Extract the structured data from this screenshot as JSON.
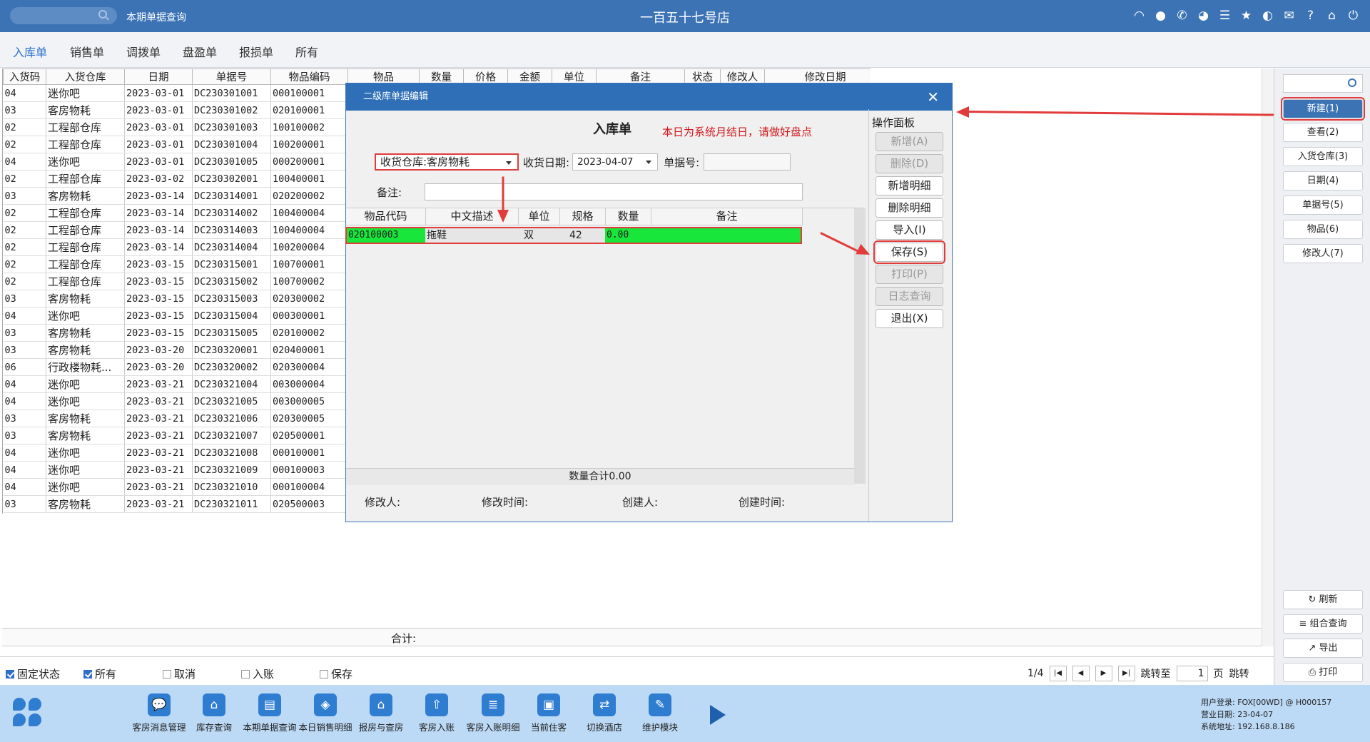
{
  "topbar": {
    "subtitle": "本期单据查询",
    "title": "一百五十七号店",
    "icons": [
      "wifi-icon",
      "chat-icon",
      "phone-icon",
      "palette-icon",
      "menu-icon",
      "star-icon",
      "theme-icon",
      "mail-icon",
      "help-icon",
      "home-icon",
      "power-icon"
    ]
  },
  "tabs": [
    {
      "label": "入库单",
      "active": true
    },
    {
      "label": "销售单"
    },
    {
      "label": "调拨单"
    },
    {
      "label": "盘盈单"
    },
    {
      "label": "报损单"
    },
    {
      "label": "所有"
    }
  ],
  "grid": {
    "columns": [
      "入货码",
      "入货仓库",
      "日期",
      "单据号",
      "物品编码",
      "物品",
      "数量",
      "价格",
      "金额",
      "单位",
      "备注",
      "状态",
      "修改人",
      "修改日期"
    ],
    "rows": [
      [
        "04",
        "迷你吧",
        "2023-03-01",
        "DC230301001",
        "000100001"
      ],
      [
        "03",
        "客房物耗",
        "2023-03-01",
        "DC230301002",
        "020100001"
      ],
      [
        "02",
        "工程部仓库",
        "2023-03-01",
        "DC230301003",
        "100100002"
      ],
      [
        "02",
        "工程部仓库",
        "2023-03-01",
        "DC230301004",
        "100200001"
      ],
      [
        "04",
        "迷你吧",
        "2023-03-01",
        "DC230301005",
        "000200001"
      ],
      [
        "02",
        "工程部仓库",
        "2023-03-02",
        "DC230302001",
        "100400001"
      ],
      [
        "03",
        "客房物耗",
        "2023-03-14",
        "DC230314001",
        "020200002"
      ],
      [
        "02",
        "工程部仓库",
        "2023-03-14",
        "DC230314002",
        "100400004"
      ],
      [
        "02",
        "工程部仓库",
        "2023-03-14",
        "DC230314003",
        "100400004"
      ],
      [
        "02",
        "工程部仓库",
        "2023-03-14",
        "DC230314004",
        "100200004"
      ],
      [
        "02",
        "工程部仓库",
        "2023-03-15",
        "DC230315001",
        "100700001"
      ],
      [
        "02",
        "工程部仓库",
        "2023-03-15",
        "DC230315002",
        "100700002"
      ],
      [
        "03",
        "客房物耗",
        "2023-03-15",
        "DC230315003",
        "020300002"
      ],
      [
        "04",
        "迷你吧",
        "2023-03-15",
        "DC230315004",
        "000300001"
      ],
      [
        "03",
        "客房物耗",
        "2023-03-15",
        "DC230315005",
        "020100002"
      ],
      [
        "03",
        "客房物耗",
        "2023-03-20",
        "DC230320001",
        "020400001"
      ],
      [
        "06",
        "行政楼物耗...",
        "2023-03-20",
        "DC230320002",
        "020300004"
      ],
      [
        "04",
        "迷你吧",
        "2023-03-21",
        "DC230321004",
        "003000004"
      ],
      [
        "04",
        "迷你吧",
        "2023-03-21",
        "DC230321005",
        "003000005"
      ],
      [
        "03",
        "客房物耗",
        "2023-03-21",
        "DC230321006",
        "020300005"
      ],
      [
        "03",
        "客房物耗",
        "2023-03-21",
        "DC230321007",
        "020500001"
      ],
      [
        "04",
        "迷你吧",
        "2023-03-21",
        "DC230321008",
        "000100001"
      ],
      [
        "04",
        "迷你吧",
        "2023-03-21",
        "DC230321009",
        "000100003"
      ],
      [
        "04",
        "迷你吧",
        "2023-03-21",
        "DC230321010",
        "000100004"
      ],
      [
        "03",
        "客房物耗",
        "2023-03-21",
        "DC230321011",
        "020500003"
      ]
    ],
    "sum_label": "合计:"
  },
  "status": {
    "filters": [
      {
        "label": "固定状态",
        "checked": true
      },
      {
        "label": "所有",
        "checked": true
      },
      {
        "label": "取消",
        "checked": false
      },
      {
        "label": "入账",
        "checked": false
      },
      {
        "label": "保存",
        "checked": false
      }
    ],
    "page": "1/4",
    "jump_label": "跳转至",
    "page_input": "1",
    "page_unit": "页",
    "jump_button": "跳转"
  },
  "right_panel": {
    "buttons": [
      "新建(1)",
      "查看(2)",
      "入货仓库(3)",
      "日期(4)",
      "单据号(5)",
      "物品(6)",
      "修改人(7)"
    ],
    "bottom_buttons": [
      "刷新",
      "组合查询",
      "导出",
      "打印"
    ]
  },
  "modal": {
    "header": "二级库单据编辑",
    "title": "入库单",
    "notice": "本日为系统月结日，请做好盘点",
    "warehouse_value": "收货仓库:客房物耗",
    "date_label": "收货日期:",
    "date_value": "2023-04-07",
    "doc_label": "单据号:",
    "remark_label": "备注:",
    "detail_columns": [
      "物品代码",
      "中文描述",
      "单位",
      "规格",
      "数量",
      "备注"
    ],
    "detail_row": [
      "020100003",
      "拖鞋",
      "双",
      "42",
      "0.00",
      ""
    ],
    "qty_total": "数量合计0.00",
    "footer": [
      "修改人:",
      "修改时间:",
      "创建人:",
      "创建时间:"
    ],
    "ops_title": "操作面板",
    "ops": [
      {
        "label": "新增(A)",
        "disabled": true
      },
      {
        "label": "删除(D)",
        "disabled": true
      },
      {
        "label": "新增明细",
        "disabled": false
      },
      {
        "label": "删除明细",
        "disabled": false
      },
      {
        "label": "导入(I)",
        "disabled": false
      },
      {
        "label": "保存(S)",
        "disabled": false
      },
      {
        "label": "打印(P)",
        "disabled": true
      },
      {
        "label": "日志查询",
        "disabled": true
      },
      {
        "label": "退出(X)",
        "disabled": false
      }
    ]
  },
  "taskbar": {
    "items": [
      "客房消息管理",
      "库存查询",
      "本期单据查询",
      "本日销售明细",
      "报房与查房",
      "客房入账",
      "客房入账明细",
      "当前住客",
      "切换酒店",
      "维护模块"
    ],
    "user_login": "用户登录:  FOX[00WD] @ H000157",
    "business_date": "营业日期:  23-04-07",
    "system_address": "系统地址:  192.168.8.186"
  },
  "colors": {
    "accent": "#3b73b5",
    "highlight": "#e23b3b",
    "row_green": "#19e63a"
  }
}
